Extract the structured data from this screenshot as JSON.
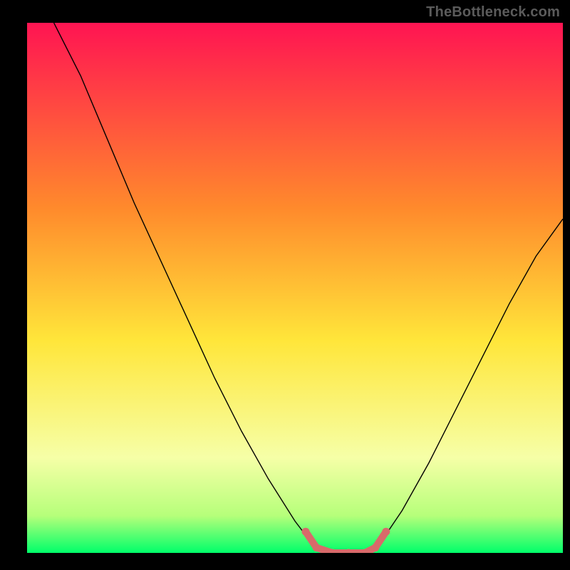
{
  "watermark": "TheBottleneck.com",
  "chart_data": {
    "type": "line",
    "title": "",
    "xlabel": "",
    "ylabel": "",
    "xlim": [
      0,
      100
    ],
    "ylim": [
      0,
      100
    ],
    "grid": false,
    "legend": false,
    "gradient": {
      "stops": [
        {
          "offset": 0,
          "color": "#ff1452"
        },
        {
          "offset": 0.35,
          "color": "#ff8a2c"
        },
        {
          "offset": 0.6,
          "color": "#ffe63a"
        },
        {
          "offset": 0.82,
          "color": "#f6ffa7"
        },
        {
          "offset": 0.93,
          "color": "#b6ff7a"
        },
        {
          "offset": 1.0,
          "color": "#00ff6a"
        }
      ]
    },
    "series": [
      {
        "name": "bottleneck-curve-left",
        "x": [
          5,
          10,
          15,
          20,
          25,
          30,
          35,
          40,
          45,
          50,
          53,
          55
        ],
        "values": [
          100,
          90,
          78,
          66,
          55,
          44,
          33,
          23,
          14,
          6,
          2,
          0
        ]
      },
      {
        "name": "bottleneck-curve-right",
        "x": [
          64,
          66,
          70,
          75,
          80,
          85,
          90,
          95,
          100
        ],
        "values": [
          0,
          2,
          8,
          17,
          27,
          37,
          47,
          56,
          63
        ]
      }
    ],
    "optimum_marker": {
      "x": [
        52,
        54,
        57,
        60,
        63,
        65,
        67
      ],
      "values": [
        4,
        1,
        0,
        0,
        0,
        1,
        4
      ]
    }
  }
}
